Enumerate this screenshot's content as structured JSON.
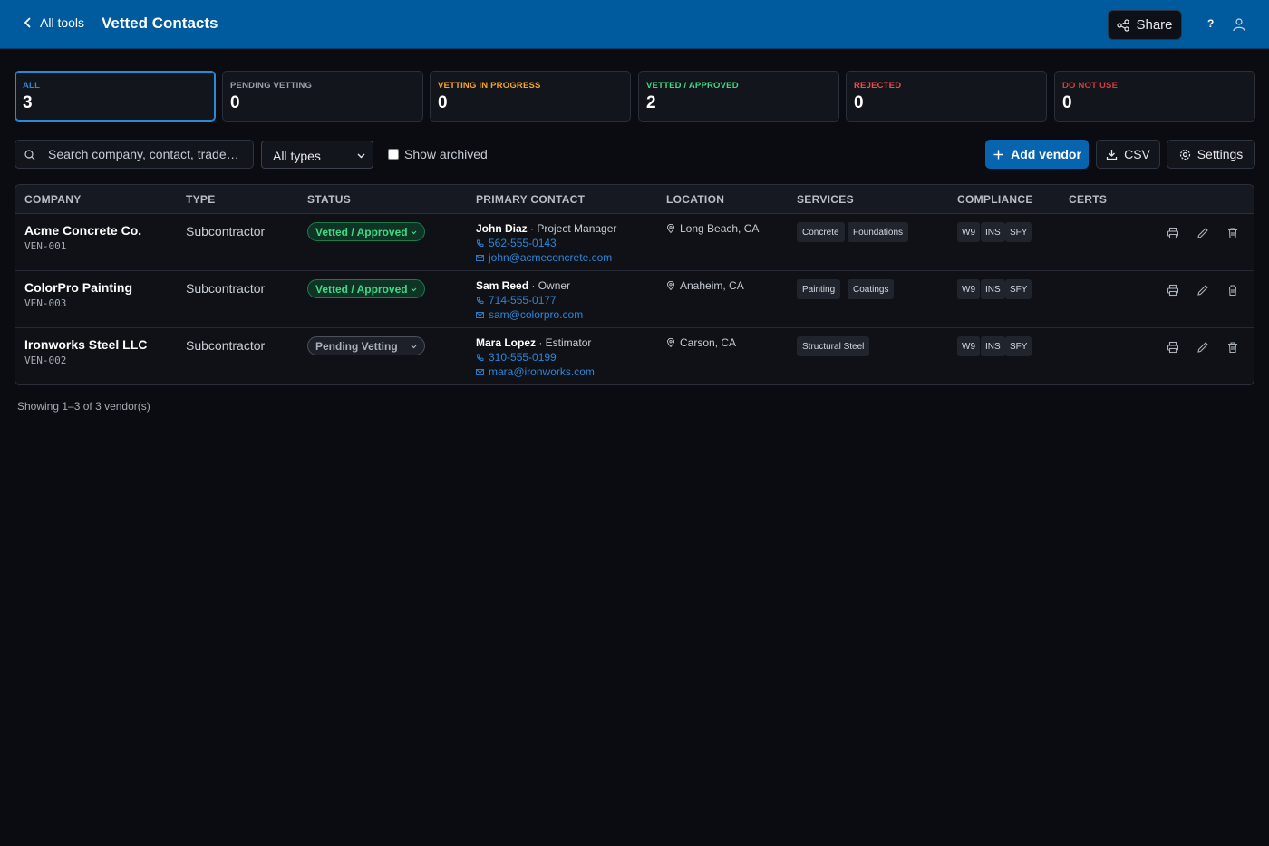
{
  "header": {
    "back_label": "All tools",
    "title": "Vetted Contacts",
    "share_label": "Share",
    "help_label": "?"
  },
  "stats": [
    {
      "label": "ALL",
      "value": "3",
      "color": "#2a8ad6"
    },
    {
      "label": "PENDING VETTING",
      "value": "0",
      "color": "#9aa0aa"
    },
    {
      "label": "VETTING IN PROGRESS",
      "value": "0",
      "color": "#f5a623"
    },
    {
      "label": "VETTED / APPROVED",
      "value": "2",
      "color": "#3ddc84"
    },
    {
      "label": "REJECTED",
      "value": "0",
      "color": "#f04c4c"
    },
    {
      "label": "DO NOT USE",
      "value": "0",
      "color": "#d83b3b"
    }
  ],
  "toolbar": {
    "search_placeholder": "Search company, contact, trade…",
    "type_filter": "All types",
    "show_archived": "Show archived",
    "add_vendor": "Add vendor",
    "csv": "CSV",
    "settings": "Settings"
  },
  "table": {
    "columns": [
      "COMPANY",
      "TYPE",
      "STATUS",
      "PRIMARY CONTACT",
      "LOCATION",
      "SERVICES",
      "COMPLIANCE",
      "CERTS"
    ],
    "rows": [
      {
        "company": "Acme Concrete Co.",
        "id": "VEN-001",
        "type": "Subcontractor",
        "status": "Vetted / Approved",
        "contact_name": "John Diaz",
        "contact_role": " · Project Manager",
        "phone": "562-555-0143",
        "email": "john@acmeconcrete.com",
        "location": "Long Beach, CA",
        "services": [
          "Concrete",
          "Foundations"
        ],
        "compliance": [
          "W9",
          "INS",
          "SFY"
        ]
      },
      {
        "company": "ColorPro Painting",
        "id": "VEN-003",
        "type": "Subcontractor",
        "status": "Vetted / Approved",
        "contact_name": "Sam Reed",
        "contact_role": " · Owner",
        "phone": "714-555-0177",
        "email": "sam@colorpro.com",
        "location": "Anaheim, CA",
        "services": [
          "Painting",
          "Coatings"
        ],
        "compliance": [
          "W9",
          "INS",
          "SFY"
        ]
      },
      {
        "company": "Ironworks Steel LLC",
        "id": "VEN-002",
        "type": "Subcontractor",
        "status": "Pending Vetting",
        "contact_name": "Mara Lopez",
        "contact_role": " · Estimator",
        "phone": "310-555-0199",
        "email": "mara@ironworks.com",
        "location": "Carson, CA",
        "services": [
          "Structural Steel"
        ],
        "compliance": [
          "W9",
          "INS",
          "SFY"
        ]
      }
    ]
  },
  "footer": {
    "summary": "Showing 1–3 of 3 vendor(s)"
  }
}
